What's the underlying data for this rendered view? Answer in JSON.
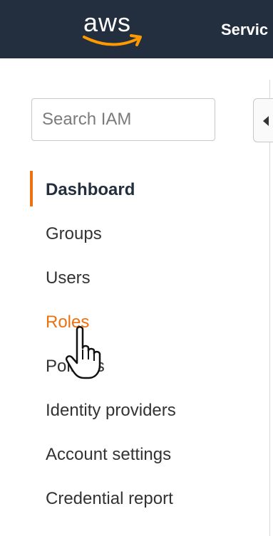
{
  "header": {
    "logo_text": "aws",
    "services_label": "Servic"
  },
  "sidebar": {
    "search_placeholder": "Search IAM",
    "items": [
      {
        "label": "Dashboard",
        "state": "active"
      },
      {
        "label": "Groups",
        "state": ""
      },
      {
        "label": "Users",
        "state": ""
      },
      {
        "label": "Roles",
        "state": "hover"
      },
      {
        "label": "Policies",
        "state": ""
      },
      {
        "label": "Identity providers",
        "state": ""
      },
      {
        "label": "Account settings",
        "state": ""
      },
      {
        "label": "Credential report",
        "state": ""
      }
    ]
  },
  "colors": {
    "header_bg": "#232f3e",
    "accent": "#ec7211",
    "text": "#333333"
  },
  "icons": {
    "collapse": "caret-left-icon",
    "cursor": "hand-pointer-icon",
    "logo_smile": "aws-smile-arrow"
  }
}
